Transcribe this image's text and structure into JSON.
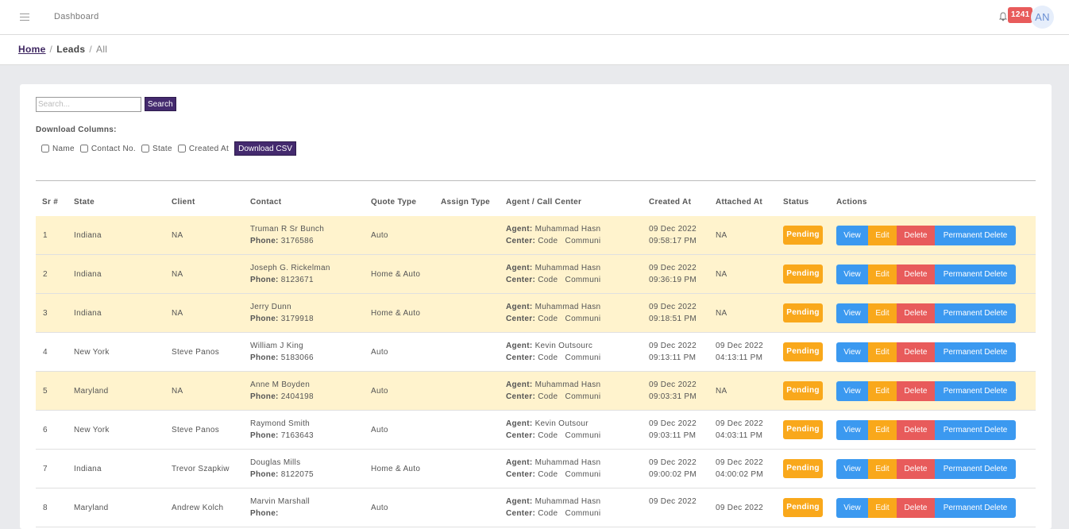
{
  "header": {
    "title": "Dashboard",
    "notification_count": "1241",
    "avatar_initials": "AN"
  },
  "breadcrumb": {
    "home": "Home",
    "sep": "/",
    "leads": "Leads",
    "current": "All"
  },
  "search": {
    "placeholder": "Search...",
    "button": "Search"
  },
  "download": {
    "label": "Download Columns:",
    "columns": [
      "Name",
      "Contact No.",
      "State",
      "Created At"
    ],
    "button": "Download CSV"
  },
  "table": {
    "headers": [
      "Sr #",
      "State",
      "Client",
      "Contact",
      "Quote Type",
      "Assign Type",
      "Agent / Call Center",
      "Created At",
      "Attached At",
      "Status",
      "Actions"
    ],
    "phone_label": "Phone:",
    "agent_label": "Agent:",
    "center_label": "Center:",
    "actions": {
      "view": "View",
      "edit": "Edit",
      "delete": "Delete",
      "permanent_delete": "Permanent Delete"
    },
    "rows": [
      {
        "sr": "1",
        "state": "Indiana",
        "client": "NA",
        "name": "Truman R Sr Bunch",
        "phone": "3176586",
        "quote": "Auto",
        "agent": "Muhammad Hasn",
        "center": "Code   Communi",
        "created_date": "09 Dec 2022",
        "created_time": "09:58:17 PM",
        "attached_date": "NA",
        "attached_time": "",
        "status": "Pending",
        "highlight": true
      },
      {
        "sr": "2",
        "state": "Indiana",
        "client": "NA",
        "name": "Joseph G. Rickelman",
        "phone": "8123671",
        "quote": "Home & Auto",
        "agent": "Muhammad Hasn",
        "center": "Code   Communi",
        "created_date": "09 Dec 2022",
        "created_time": "09:36:19 PM",
        "attached_date": "NA",
        "attached_time": "",
        "status": "Pending",
        "highlight": true
      },
      {
        "sr": "3",
        "state": "Indiana",
        "client": "NA",
        "name": "Jerry Dunn",
        "phone": "3179918",
        "quote": "Home & Auto",
        "agent": "Muhammad Hasn",
        "center": "Code   Communi",
        "created_date": "09 Dec 2022",
        "created_time": "09:18:51 PM",
        "attached_date": "NA",
        "attached_time": "",
        "status": "Pending",
        "highlight": true
      },
      {
        "sr": "4",
        "state": "New York",
        "client": "Steve Panos",
        "name": "William J King",
        "phone": "5183066",
        "quote": "Auto",
        "agent": "Kevin Outsourc",
        "center": "Code   Communi",
        "created_date": "09 Dec 2022",
        "created_time": "09:13:11 PM",
        "attached_date": "09 Dec 2022",
        "attached_time": "04:13:11 PM",
        "status": "Pending",
        "highlight": false
      },
      {
        "sr": "5",
        "state": "Maryland",
        "client": "NA",
        "name": "Anne M Boyden",
        "phone": "2404198",
        "quote": "Auto",
        "agent": "Muhammad Hasn",
        "center": "Code   Communi",
        "created_date": "09 Dec 2022",
        "created_time": "09:03:31 PM",
        "attached_date": "NA",
        "attached_time": "",
        "status": "Pending",
        "highlight": true
      },
      {
        "sr": "6",
        "state": "New York",
        "client": "Steve Panos",
        "name": "Raymond Smith",
        "phone": "7163643",
        "quote": "Auto",
        "agent": "Kevin Outsour",
        "center": "Code   Communi",
        "created_date": "09 Dec 2022",
        "created_time": "09:03:11 PM",
        "attached_date": "09 Dec 2022",
        "attached_time": "04:03:11 PM",
        "status": "Pending",
        "highlight": false
      },
      {
        "sr": "7",
        "state": "Indiana",
        "client": "Trevor Szapkiw",
        "name": "Douglas Mills",
        "phone": "8122075",
        "quote": "Home & Auto",
        "agent": "Muhammad Hasn",
        "center": "Code   Communi",
        "created_date": "09 Dec 2022",
        "created_time": "09:00:02 PM",
        "attached_date": "09 Dec 2022",
        "attached_time": "04:00:02 PM",
        "status": "Pending",
        "highlight": false
      },
      {
        "sr": "8",
        "state": "Maryland",
        "client": "Andrew Kolch",
        "name": "Marvin Marshall",
        "phone": "",
        "quote": "Auto",
        "agent": "Muhammad Hasn",
        "center": "Code   Communi",
        "created_date": "09 Dec 2022",
        "created_time": "",
        "attached_date": "09 Dec 2022",
        "attached_time": "",
        "status": "Pending",
        "highlight": false
      }
    ]
  }
}
